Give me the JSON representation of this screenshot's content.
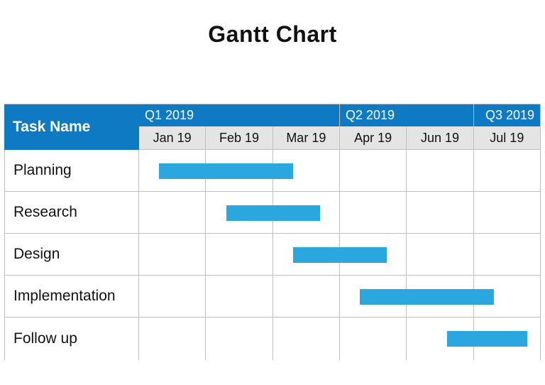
{
  "title": "Gantt Chart",
  "header": {
    "task_name_label": "Task Name",
    "quarters": [
      {
        "label": "Q1 2019",
        "span": 3,
        "align": "left"
      },
      {
        "label": "Q2 2019",
        "span": 2,
        "align": "left"
      },
      {
        "label": "Q3 2019",
        "span": 1,
        "align": "right"
      }
    ],
    "months": [
      "Jan 19",
      "Feb 19",
      "Mar 19",
      "Apr 19",
      "Jun 19",
      "Jul 19"
    ]
  },
  "tasks": [
    {
      "name": "Planning"
    },
    {
      "name": "Research"
    },
    {
      "name": "Design"
    },
    {
      "name": "Implementation"
    },
    {
      "name": "Follow up"
    }
  ],
  "colors": {
    "header_bg": "#0f7ac4",
    "month_bg": "#e4e4e4",
    "bar": "#2ba7e0",
    "grid": "#bfbfbf"
  },
  "chart_data": {
    "type": "bar",
    "title": "Gantt Chart",
    "xlabel": "",
    "ylabel": "",
    "categories": [
      "Jan 19",
      "Feb 19",
      "Mar 19",
      "Apr 19",
      "Jun 19",
      "Jul 19"
    ],
    "x_range_months": [
      0,
      6
    ],
    "series": [
      {
        "name": "Planning",
        "start_month": 0.3,
        "end_month": 2.3
      },
      {
        "name": "Research",
        "start_month": 1.3,
        "end_month": 2.7
      },
      {
        "name": "Design",
        "start_month": 2.3,
        "end_month": 3.7
      },
      {
        "name": "Implementation",
        "start_month": 3.3,
        "end_month": 5.3
      },
      {
        "name": "Follow up",
        "start_month": 4.6,
        "end_month": 5.8
      }
    ],
    "quarter_groups": [
      {
        "label": "Q1 2019",
        "months": [
          "Jan 19",
          "Feb 19",
          "Mar 19"
        ]
      },
      {
        "label": "Q2 2019",
        "months": [
          "Apr 19",
          "Jun 19"
        ]
      },
      {
        "label": "Q3 2019",
        "months": [
          "Jul 19"
        ]
      }
    ]
  }
}
